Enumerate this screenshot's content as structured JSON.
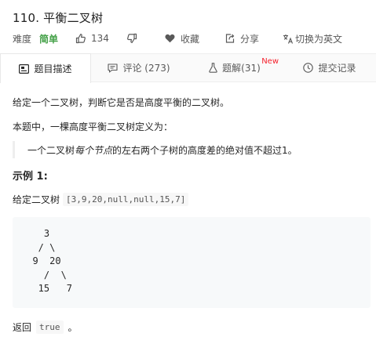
{
  "problem": {
    "title": "110. 平衡二叉树",
    "difficulty_label": "难度",
    "difficulty_value": "简单",
    "likes": "134",
    "favorite_label": "收藏",
    "share_label": "分享",
    "lang_switch_label": "切换为英文"
  },
  "tabs": [
    {
      "label": "题目描述",
      "icon": "description-icon",
      "active": true
    },
    {
      "label": "评论 (273)",
      "icon": "comment-icon",
      "active": false
    },
    {
      "label": "题解(31)",
      "icon": "flask-icon",
      "active": false,
      "badge": "New"
    },
    {
      "label": "提交记录",
      "icon": "clock-icon",
      "active": false
    }
  ],
  "content": {
    "intro": "给定一个二叉树，判断它是否是高度平衡的二叉树。",
    "definition_intro": "本题中，一棵高度平衡二叉树定义为：",
    "quote_prefix": "一个二叉树",
    "quote_emphasis": "每个节点",
    "quote_suffix": "的左右两个子树的高度差的绝对值不超过1。",
    "example_title": "示例 1:",
    "given_label": "给定二叉树",
    "given_value": "[3,9,20,null,null,15,7]",
    "tree_block": "    3\n   / \\\n  9  20\n    /  \\\n   15   7",
    "return_label": "返回",
    "return_value": "true",
    "return_suffix": "。"
  },
  "colors": {
    "easy": "#43a047",
    "new_badge": "#f5222d"
  }
}
